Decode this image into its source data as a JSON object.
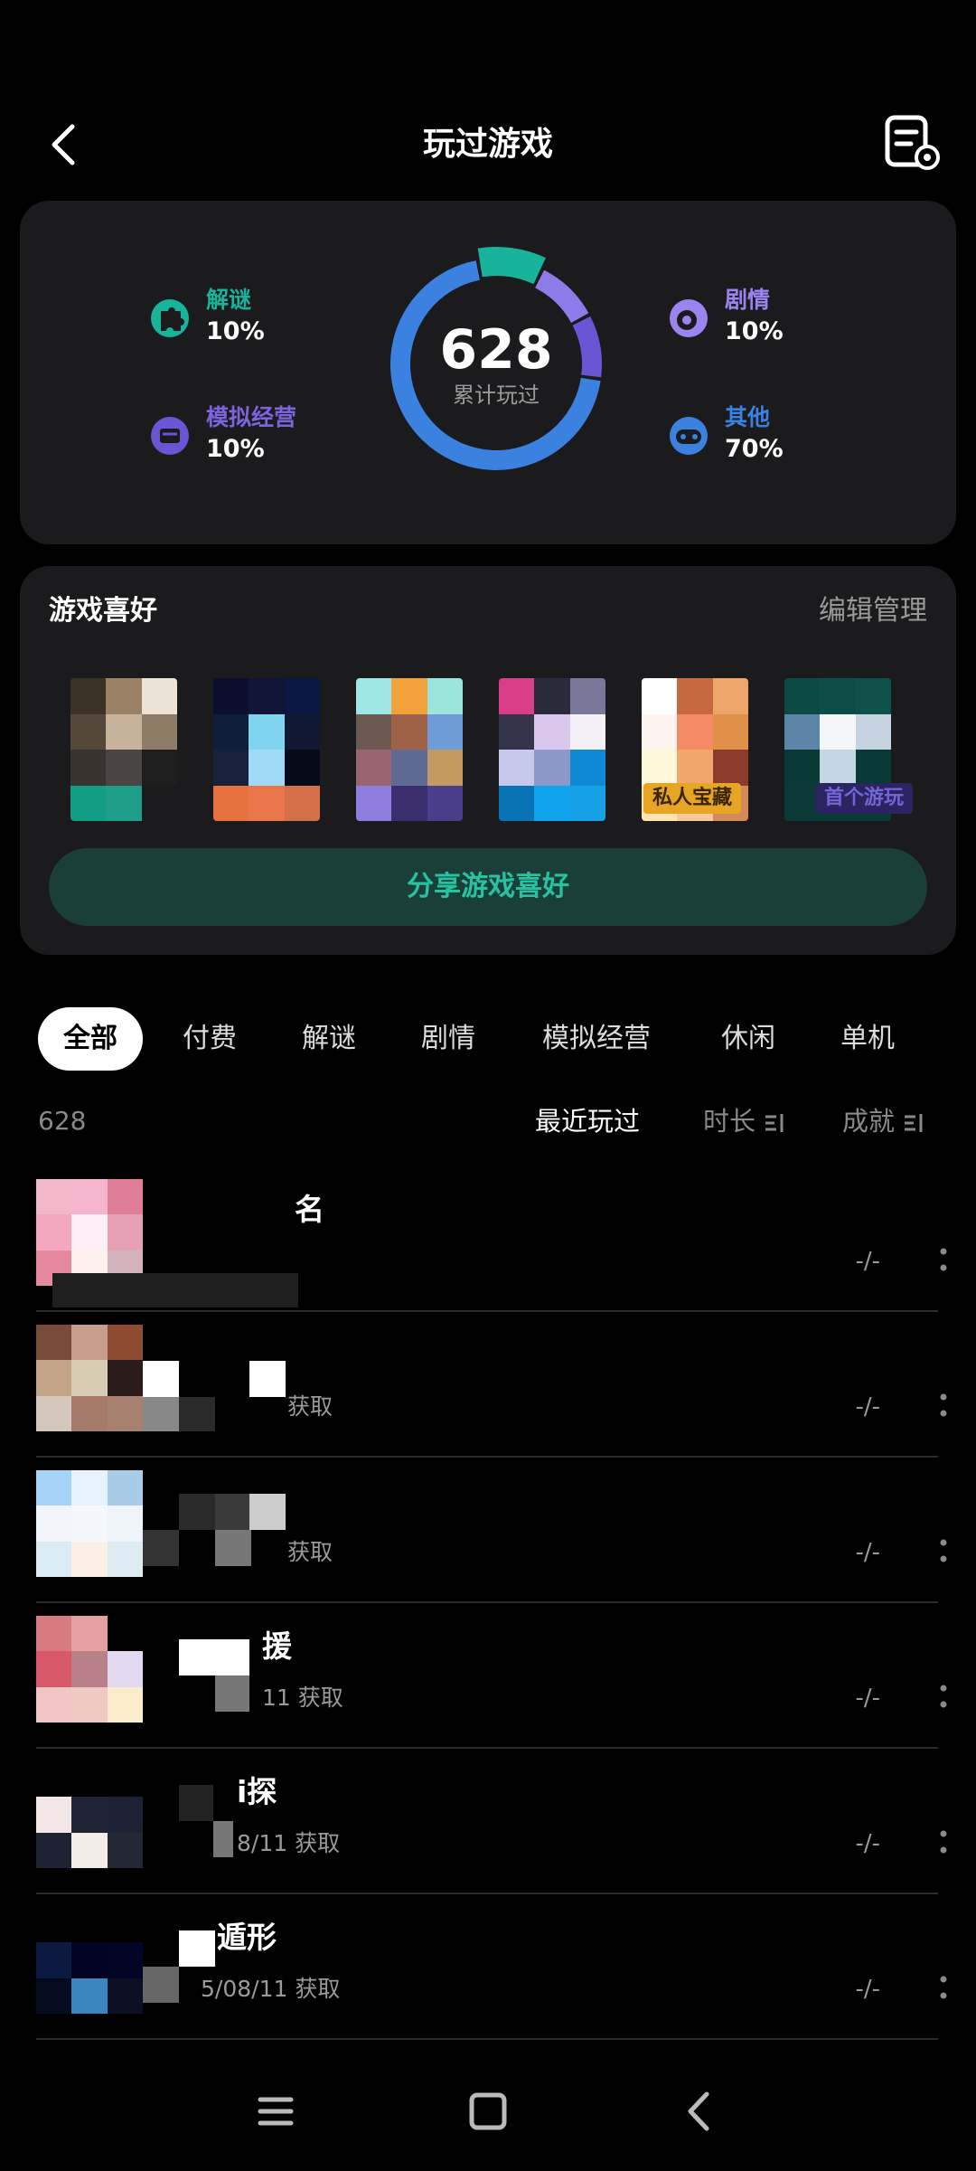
{
  "header": {
    "title": "玩过游戏",
    "back_icon": "back-arrow-icon",
    "settings_icon": "list-settings-icon"
  },
  "summary": {
    "total": "628",
    "caption": "累计玩过",
    "donut": [
      {
        "name": "解谜",
        "fraction": 0.1,
        "color": "#17b39a"
      },
      {
        "name": "剧情",
        "fraction": 0.1,
        "color": "#8c7be8"
      },
      {
        "name": "模拟经营",
        "fraction": 0.1,
        "color": "#6a56d4"
      },
      {
        "name": "其他",
        "fraction": 0.7,
        "color": "#3b82e0"
      }
    ],
    "categories": [
      {
        "name": "解谜",
        "pct": "10%",
        "color": "#17b39a",
        "icon": "puzzle-icon"
      },
      {
        "name": "模拟经营",
        "pct": "10%",
        "color": "#7c64e0",
        "icon": "simulation-icon"
      },
      {
        "name": "剧情",
        "pct": "10%",
        "color": "#9a84f0",
        "icon": "story-icon"
      },
      {
        "name": "其他",
        "pct": "70%",
        "color": "#3b82e0",
        "icon": "gamepad-icon"
      }
    ]
  },
  "preference": {
    "title": "游戏喜好",
    "edit_label": "编辑管理",
    "share_label": "分享游戏喜好",
    "badges": [
      "私人宝藏",
      "首个游玩"
    ],
    "badge_colors": [
      "#e6a623",
      "#7563d8"
    ]
  },
  "tabs": [
    "全部",
    "付费",
    "解谜",
    "剧情",
    "模拟经营",
    "休闲",
    "单机"
  ],
  "sort": {
    "count": "628",
    "options": [
      "最近玩过",
      "时长",
      "成就"
    ]
  },
  "games": [
    {
      "name": "名",
      "date": "",
      "achievement": "-/-"
    },
    {
      "name": "",
      "date": "获取",
      "achievement": "-/-"
    },
    {
      "name": "",
      "date": "获取",
      "achievement": "-/-"
    },
    {
      "name": "援",
      "date": "11 获取",
      "achievement": "-/-"
    },
    {
      "name": "i探",
      "date": "8/11 获取",
      "achievement": "-/-"
    },
    {
      "name": "遁形",
      "date": "5/08/11 获取",
      "achievement": "-/-"
    }
  ],
  "navbar": {
    "menu_icon": "menu-icon",
    "home_icon": "home-icon",
    "back_icon": "back-nav-icon"
  }
}
